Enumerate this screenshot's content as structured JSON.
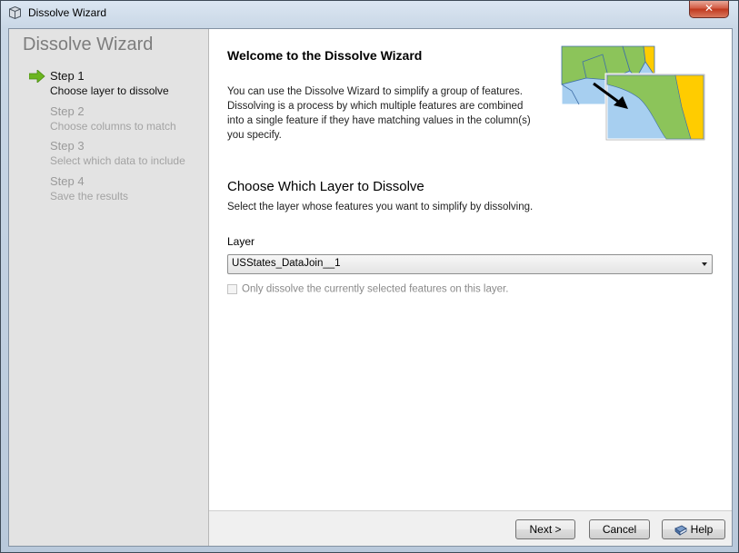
{
  "window": {
    "title": "Dissolve Wizard",
    "close_glyph": "✕"
  },
  "sidebar": {
    "title": "Dissolve Wizard",
    "steps": [
      {
        "name": "Step 1",
        "description": "Choose layer to dissolve",
        "active": true
      },
      {
        "name": "Step 2",
        "description": "Choose columns to match",
        "active": false
      },
      {
        "name": "Step 3",
        "description": "Select which data to include",
        "active": false
      },
      {
        "name": "Step 4",
        "description": "Save the results",
        "active": false
      }
    ]
  },
  "main": {
    "welcome_title": "Welcome to the Dissolve Wizard",
    "intro_text": "You can use the Dissolve Wizard to simplify a group of features. Dissolving is a process by which multiple features are combined into a single feature if they have matching values in the column(s) you specify.",
    "section_title": "Choose Which Layer to Dissolve",
    "section_description": "Select the layer whose features you want to simplify by dissolving.",
    "layer_label": "Layer",
    "layer_selected": "USStates_DataJoin__1",
    "checkbox_label": "Only dissolve the currently selected features on this layer.",
    "checkbox_checked": false,
    "checkbox_enabled": false
  },
  "footer": {
    "next_label": "Next >",
    "cancel_label": "Cancel",
    "help_label": "Help"
  },
  "colors": {
    "map_green": "#8cc45a",
    "map_blue": "#a7cff0",
    "map_yellow": "#ffcc00",
    "step_arrow": "#6bb51f"
  }
}
